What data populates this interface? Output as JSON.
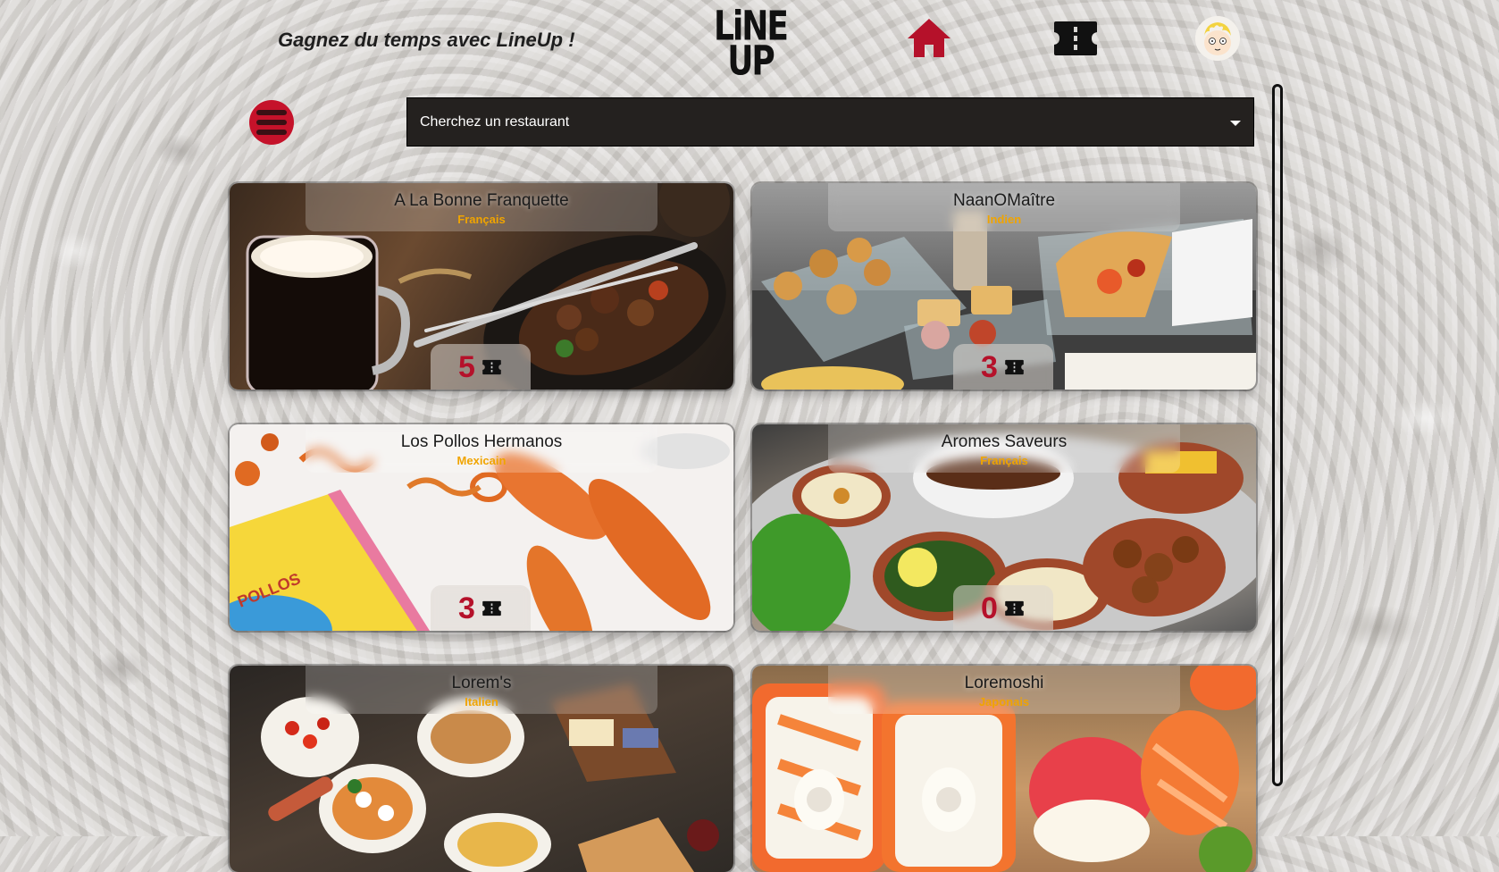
{
  "header": {
    "tagline": "Gagnez du temps avec LineUp !",
    "logo_line1": "LiNE",
    "logo_line2": "UP"
  },
  "nav": {
    "home_icon": "home-icon",
    "tickets_icon": "ticket-icon",
    "avatar_icon": "user-avatar"
  },
  "search": {
    "placeholder": "Cherchez un restaurant"
  },
  "colors": {
    "accent": "#c5122a",
    "cuisine": "#f0a400",
    "search_bg": "#24211f"
  },
  "restaurants": [
    {
      "name": "A La Bonne Franquette",
      "cuisine": "Français",
      "tickets": "5"
    },
    {
      "name": "NaanOMaître",
      "cuisine": "Indien",
      "tickets": "3"
    },
    {
      "name": "Los Pollos Hermanos",
      "cuisine": "Mexicain",
      "tickets": "3"
    },
    {
      "name": "Aromes Saveurs",
      "cuisine": "Français",
      "tickets": "0"
    },
    {
      "name": "Lorem's",
      "cuisine": "Italien",
      "tickets": ""
    },
    {
      "name": "Loremoshi",
      "cuisine": "Japonais",
      "tickets": ""
    }
  ]
}
